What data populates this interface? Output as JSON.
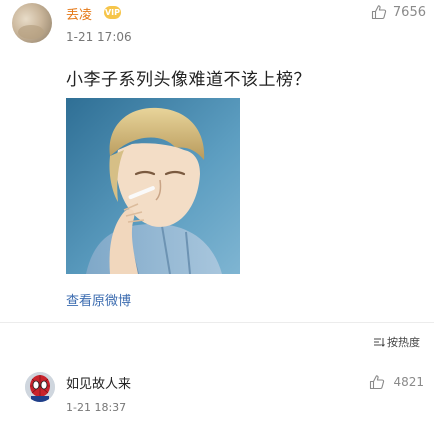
{
  "post": {
    "username": "丢凌",
    "badge": "VIP",
    "timestamp": "1-21 17:06",
    "like_count": "7656",
    "text": "小李子系列头像难道不该上榜？",
    "view_original_link": "查看原微博"
  },
  "sort": {
    "label": "按热度"
  },
  "comment": {
    "username": "如见故人来",
    "timestamp": "1-21 18:37",
    "like_count": "4821"
  },
  "colors": {
    "username": "#e57a1a",
    "link": "#3c6cb0",
    "muted": "#8a8a8a"
  }
}
